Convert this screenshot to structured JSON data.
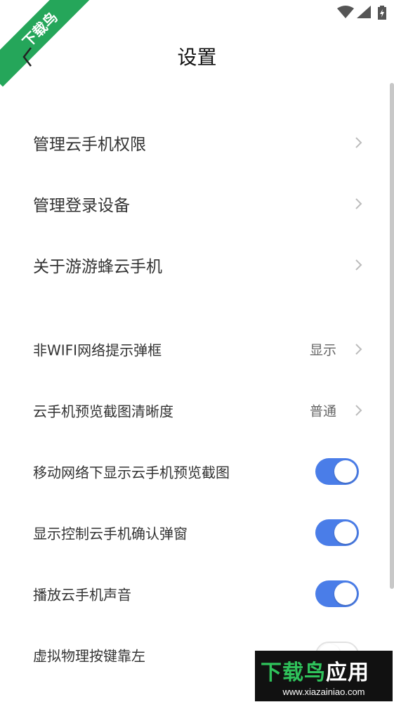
{
  "watermark": {
    "ribbon_text": "下载鸟",
    "brand_text_green": "下载鸟",
    "brand_text_white": "应用",
    "brand_url": "www.xiazainiao.com"
  },
  "header": {
    "title": "设置"
  },
  "section1": [
    {
      "label": "管理云手机权限"
    },
    {
      "label": "管理登录设备"
    },
    {
      "label": "关于游游蜂云手机"
    }
  ],
  "section2": [
    {
      "label": "非WIFI网络提示弹框",
      "value": "显示"
    },
    {
      "label": "云手机预览截图清晰度",
      "value": "普通"
    },
    {
      "label": "移动网络下显示云手机预览截图",
      "toggle": "on"
    },
    {
      "label": "显示控制云手机确认弹窗",
      "toggle": "on"
    },
    {
      "label": "播放云手机声音",
      "toggle": "on"
    },
    {
      "label": "虚拟物理按键靠左",
      "toggle": "off"
    }
  ],
  "colors": {
    "accent": "#4a7de8",
    "ribbon": "#25a65a"
  }
}
